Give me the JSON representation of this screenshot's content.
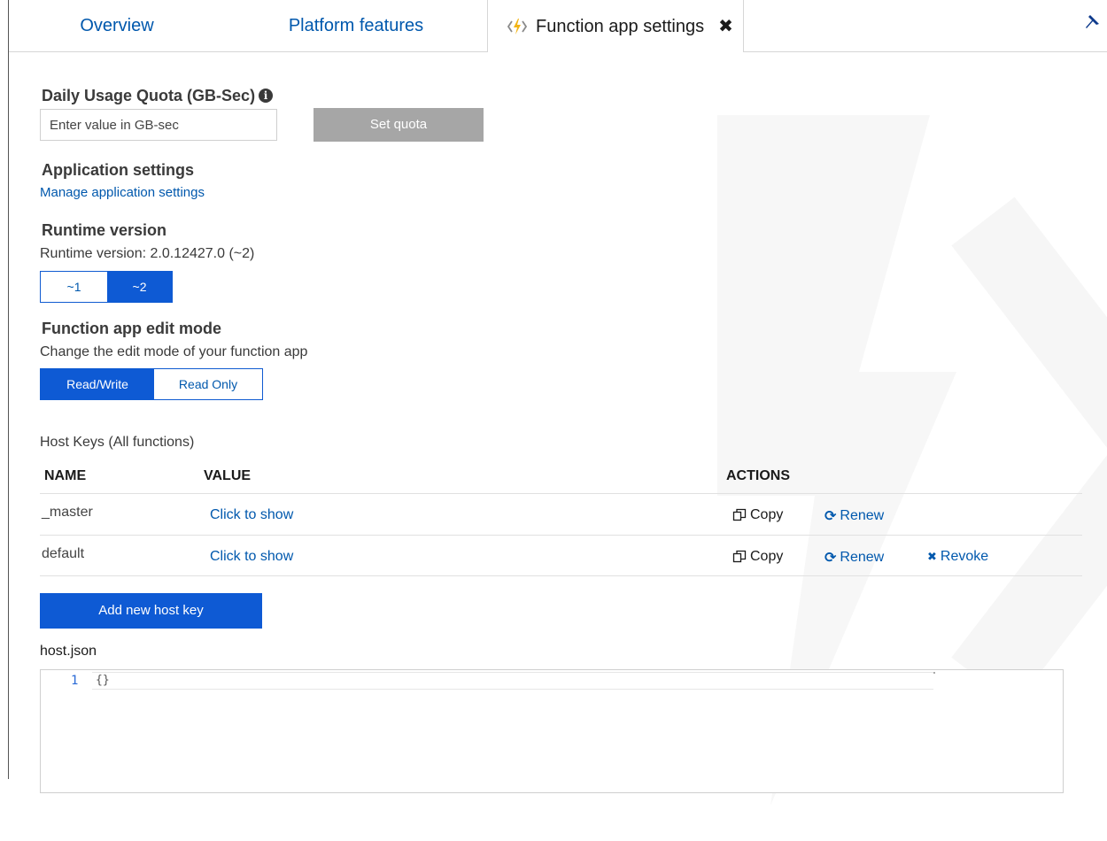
{
  "tabs": {
    "overview": "Overview",
    "platform": "Platform features",
    "settings": "Function app settings"
  },
  "quota": {
    "title": "Daily Usage Quota (GB-Sec)",
    "placeholder": "Enter value in GB-sec",
    "button": "Set quota"
  },
  "app_settings": {
    "title": "Application settings",
    "link": "Manage application settings"
  },
  "runtime": {
    "title": "Runtime version",
    "current": "Runtime version: 2.0.12427.0 (~2)",
    "options": [
      "~1",
      "~2"
    ],
    "selected": "~2"
  },
  "edit_mode": {
    "title": "Function app edit mode",
    "description": "Change the edit mode of your function app",
    "options": [
      "Read/Write",
      "Read Only"
    ],
    "selected": "Read/Write"
  },
  "host_keys": {
    "title": "Host Keys (All functions)",
    "headers": {
      "name": "NAME",
      "value": "VALUE",
      "actions": "ACTIONS"
    },
    "rows": [
      {
        "name": "_master",
        "value": "Click to show",
        "copy": "Copy",
        "renew": "Renew"
      },
      {
        "name": "default",
        "value": "Click to show",
        "copy": "Copy",
        "renew": "Renew",
        "revoke": "Revoke"
      }
    ],
    "add_button": "Add new host key"
  },
  "host_json": {
    "label": "host.json",
    "line_number": "1",
    "content": "{}"
  },
  "colors": {
    "accent": "#0e5ad4",
    "link": "#0058ad",
    "disabled_button": "#a6a6a6"
  },
  "icons": [
    "function-bolt-icon",
    "close-icon",
    "pin-icon",
    "info-icon",
    "copy-icon",
    "refresh-icon",
    "x-icon"
  ]
}
